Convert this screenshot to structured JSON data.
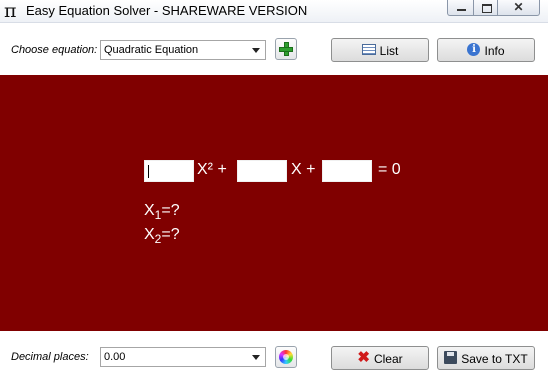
{
  "window": {
    "app_icon": "π",
    "title": "Easy Equation Solver - SHAREWARE VERSION"
  },
  "toolbar": {
    "equation_label": "Choose equation:",
    "equation_value": "Quadratic Equation",
    "list_label": "List",
    "info_label": "Info"
  },
  "equation": {
    "a_value": "",
    "b_value": "",
    "c_value": "",
    "term_x2": "X² +",
    "term_x": "X +",
    "term_eq": "= 0",
    "x1_label": "X",
    "x1_sub": "1",
    "x1_value": "=?",
    "x2_label": "X",
    "x2_sub": "2",
    "x2_value": "=?"
  },
  "bottom": {
    "decimal_label": "Decimal places:",
    "decimal_value": "0.00",
    "clear_label": "Clear",
    "save_label": "Save to TXT"
  },
  "colors": {
    "canvas_bg": "#800000",
    "plus_green": "#2e9e2e",
    "clear_red": "#d01a1a"
  }
}
